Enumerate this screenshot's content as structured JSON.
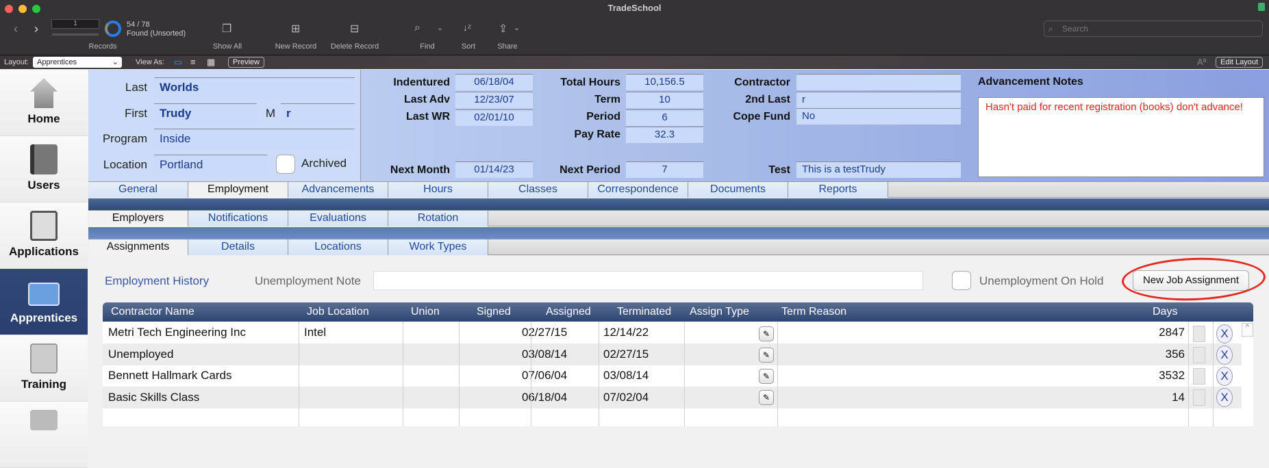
{
  "window": {
    "title": "TradeSchool"
  },
  "toolbar": {
    "record_number": "1",
    "found_count": "54 / 78",
    "found_status": "Found (Unsorted)",
    "records_label": "Records",
    "show_all": "Show All",
    "new_record": "New Record",
    "delete_record": "Delete Record",
    "find": "Find",
    "sort": "Sort",
    "share": "Share",
    "search_placeholder": "Search",
    "found_fraction": 0.69
  },
  "layoutbar": {
    "layout_label": "Layout:",
    "layout_value": "Apprentices",
    "view_as_label": "View As:",
    "preview": "Preview",
    "edit_layout": "Edit Layout"
  },
  "sidebar": {
    "items": [
      {
        "label": "Home",
        "icon": "home-icon"
      },
      {
        "label": "Users",
        "icon": "address-book-icon"
      },
      {
        "label": "Applications",
        "icon": "clipboard-icon"
      },
      {
        "label": "Apprentices",
        "icon": "id-badge-icon",
        "active": true
      },
      {
        "label": "Training",
        "icon": "certificate-icon"
      }
    ]
  },
  "record": {
    "last_label": "Last",
    "last": "Worlds",
    "first_label": "First",
    "first": "Trudy",
    "m_label": "M",
    "middle": "r",
    "program_label": "Program",
    "program": "Inside",
    "location_label": "Location",
    "location": "Portland",
    "archived_label": "Archived",
    "indentured_label": "Indentured",
    "indentured": "06/18/04",
    "last_adv_label": "Last Adv",
    "last_adv": "12/23/07",
    "last_wr_label": "Last WR",
    "last_wr": "02/01/10",
    "next_month_label": "Next Month",
    "next_month": "01/14/23",
    "total_hours_label": "Total Hours",
    "total_hours": "10,156.5",
    "term_label": "Term",
    "term": "10",
    "period_label": "Period",
    "period": "6",
    "pay_rate_label": "Pay Rate",
    "pay_rate": "32.3",
    "next_period_label": "Next Period",
    "next_period": "7",
    "contractor_label": "Contractor",
    "contractor": "",
    "second_last_label": "2nd Last",
    "second_last": "r",
    "cope_fund_label": "Cope Fund",
    "cope_fund": "No",
    "test_label": "Test",
    "test": "This is a testTrudy",
    "adv_notes_label": "Advancement Notes",
    "adv_notes": "Hasn't paid for recent registration (books) don't advance!"
  },
  "tabs": {
    "main": [
      "General",
      "Employment",
      "Advancements",
      "Hours",
      "Classes",
      "Correspondence",
      "Documents",
      "Reports"
    ],
    "main_active": "Employment",
    "sub": [
      "Employers",
      "Notifications",
      "Evaluations",
      "Rotation"
    ],
    "sub_active": "Employers",
    "sub2": [
      "Assignments",
      "Details",
      "Locations",
      "Work Types"
    ],
    "sub2_active": "Assignments"
  },
  "employment": {
    "history_label": "Employment History",
    "unemployment_note_label": "Unemployment Note",
    "unemployment_note": "",
    "on_hold_label": "Unemployment On Hold",
    "new_job_button": "New Job Assignment",
    "columns": [
      "Contractor Name",
      "Job Location",
      "Union",
      "Signed",
      "Assigned",
      "Terminated",
      "Assign Type",
      "Term Reason",
      "Days"
    ],
    "rows": [
      {
        "contractor": "Metri Tech Engineering Inc",
        "job_location": "Intel",
        "union": "",
        "signed": "",
        "assigned": "02/27/15",
        "terminated": "12/14/22",
        "term_reason": "",
        "days": "2847"
      },
      {
        "contractor": "Unemployed",
        "job_location": "",
        "union": "",
        "signed": "",
        "assigned": "03/08/14",
        "terminated": "02/27/15",
        "term_reason": "",
        "days": "356"
      },
      {
        "contractor": "Bennett Hallmark Cards",
        "job_location": "",
        "union": "",
        "signed": "",
        "assigned": "07/06/04",
        "terminated": "03/08/14",
        "term_reason": "",
        "days": "3532"
      },
      {
        "contractor": "Basic Skills Class",
        "job_location": "",
        "union": "",
        "signed": "",
        "assigned": "06/18/04",
        "terminated": "07/02/04",
        "term_reason": "",
        "days": "14"
      }
    ],
    "delete_label": "X"
  },
  "colors": {
    "accent": "#2c4674",
    "notes_text": "#e2231a",
    "field_text": "#1c3a8c",
    "highlight_circle": "#e8261b"
  }
}
